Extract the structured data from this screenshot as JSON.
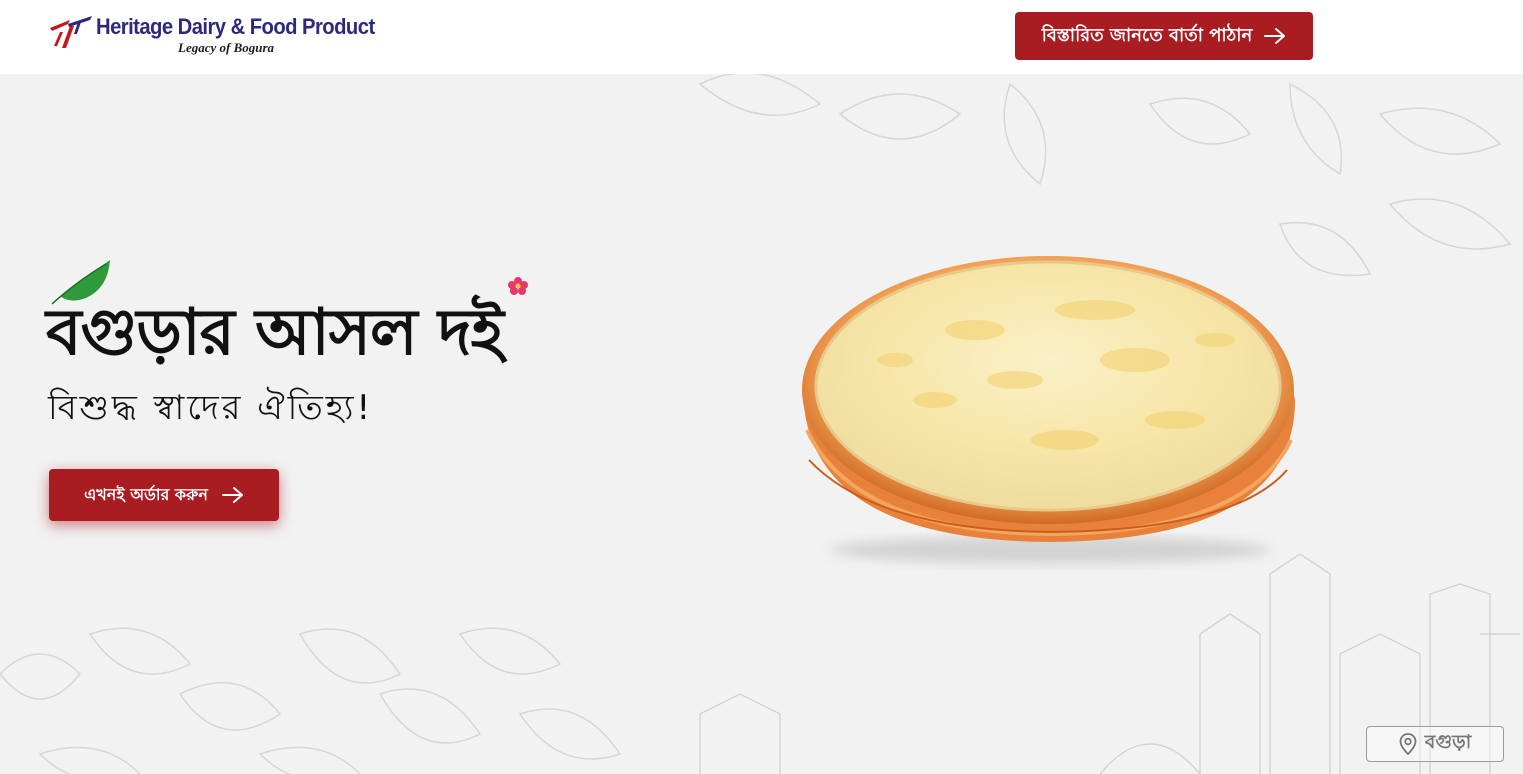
{
  "header": {
    "brand_name": "Heritage Dairy & Food Product",
    "brand_tagline": "Legacy of Bogura",
    "contact_button_label": "বিস্তারিত জানতে বার্তা পাঠান"
  },
  "hero": {
    "title": "বগুড়ার আসল দই",
    "subtitle": "বিশুদ্ধ স্বাদের ঐতিহ্য!",
    "order_button_label": "এখনই অর্ডার করুন",
    "product_image": "clay pot of yogurt (doi)"
  },
  "location_badge": {
    "label": "বগুড়া"
  },
  "icons": {
    "logo": "heritage-logo-mark",
    "arrow": "arrow-right-icon",
    "leaf": "green-leaf-icon",
    "flower": "pink-flower-icon",
    "pin": "map-pin-icon"
  },
  "colors": {
    "primary": "#a81c22",
    "brand_text": "#2d2a7e",
    "background": "#f2f2f2"
  }
}
